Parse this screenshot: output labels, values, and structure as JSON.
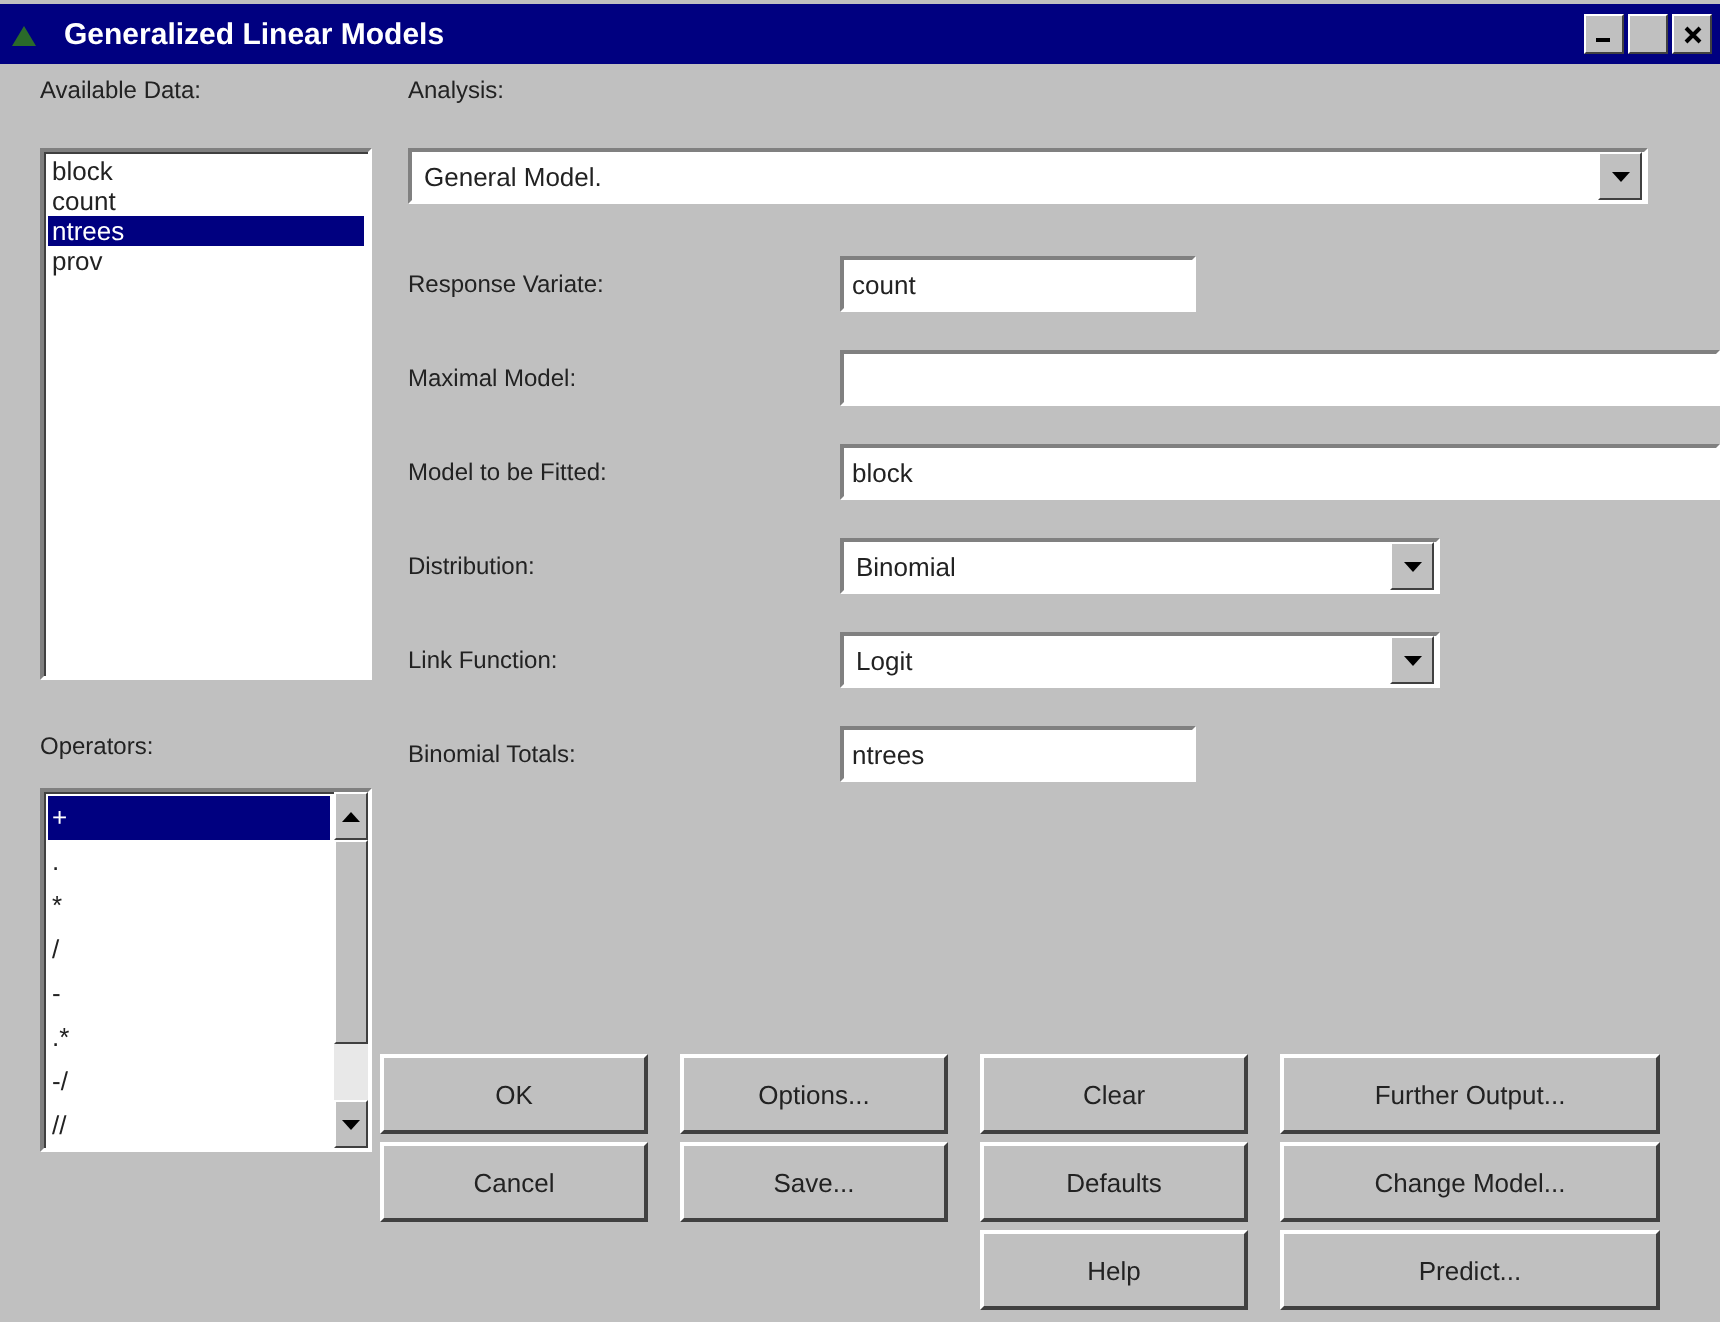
{
  "window": {
    "title": "Generalized Linear Models"
  },
  "available_data": {
    "label": "Available Data:",
    "items": [
      {
        "text": "block",
        "selected": false
      },
      {
        "text": "count",
        "selected": false
      },
      {
        "text": "ntrees",
        "selected": true
      },
      {
        "text": "prov",
        "selected": false
      }
    ]
  },
  "operators": {
    "label": "Operators:",
    "items": [
      {
        "text": "+",
        "selected": true
      },
      {
        "text": ".",
        "selected": false
      },
      {
        "text": "*",
        "selected": false
      },
      {
        "text": "/",
        "selected": false
      },
      {
        "text": "-",
        "selected": false
      },
      {
        "text": ".*",
        "selected": false
      },
      {
        "text": "-/",
        "selected": false
      },
      {
        "text": "//",
        "selected": false
      }
    ]
  },
  "analysis": {
    "label": "Analysis:",
    "value": "General Model."
  },
  "fields": [
    {
      "kind": "short_text",
      "label": "Response Variate:",
      "value": "count"
    },
    {
      "kind": "long_text",
      "label": "Maximal Model:"
    },
    {
      "kind": "long_text",
      "label": "Model to be Fitted:",
      "value": "block"
    },
    {
      "kind": "dropdown",
      "label": "Distribution:",
      "value": "Binomial"
    },
    {
      "kind": "dropdown",
      "label": "Link Function:",
      "value": "Logit"
    },
    {
      "kind": "short_text",
      "label": "Binomial Totals:",
      "value": "ntrees"
    }
  ],
  "buttons": [
    [
      "OK",
      "Options...",
      "Clear",
      "Further Output..."
    ],
    [
      "Cancel",
      "Save...",
      "Defaults",
      "Change Model..."
    ],
    [
      "Help",
      "Predict..."
    ]
  ]
}
